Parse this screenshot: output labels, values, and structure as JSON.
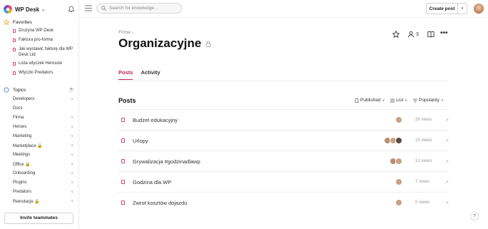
{
  "workspace": {
    "name": "WP Desk"
  },
  "sidebar": {
    "favorites_title": "Favorites",
    "favorites": [
      {
        "label": "Drużyna WP Desk"
      },
      {
        "label": "Faktura pro-forma"
      },
      {
        "label": "Jak wystawić fakturę dla WP Desk Ltd"
      },
      {
        "label": "Lista wtyczek Herosów"
      },
      {
        "label": "Wtyczki Predators"
      }
    ],
    "topics_title": "Topics",
    "topics": [
      {
        "label": "Developers"
      },
      {
        "label": "Docs"
      },
      {
        "label": "Firma"
      },
      {
        "label": "Heroes"
      },
      {
        "label": "Marketing"
      },
      {
        "label": "Marketplace 🔒"
      },
      {
        "label": "Meetings"
      },
      {
        "label": "Office 🔒"
      },
      {
        "label": "Onboarding"
      },
      {
        "label": "Plugins"
      },
      {
        "label": "Predators"
      },
      {
        "label": "Rekrutacje 🔒"
      }
    ],
    "invite_label": "Invite teammates"
  },
  "topbar": {
    "search_placeholder": "Search for knowledge...",
    "create_label": "Create post"
  },
  "page": {
    "breadcrumb": "Firma ›",
    "title": "Organizacyjne",
    "members_count": "3",
    "tabs": [
      {
        "label": "Posts"
      },
      {
        "label": "Activity"
      }
    ],
    "section_title": "Posts",
    "filters": [
      {
        "label": "Published"
      },
      {
        "label": "List"
      },
      {
        "label": "Popularity"
      }
    ],
    "posts": [
      {
        "title": "Budżet edukacyjny",
        "views": "28 views"
      },
      {
        "title": "Urlopy",
        "views": "15 views"
      },
      {
        "title": "Grywalizacja #godzinadlawp",
        "views": "12 views"
      },
      {
        "title": "Godzina dla WP",
        "views": "7 views"
      },
      {
        "title": "Zwrot kosztów dojazdu",
        "views": "0 views"
      }
    ]
  },
  "help_label": "?",
  "colors": {
    "accent": "#c01e5a",
    "favorite_star": "#f5a623",
    "topics_ring": "#4a7bd0"
  }
}
